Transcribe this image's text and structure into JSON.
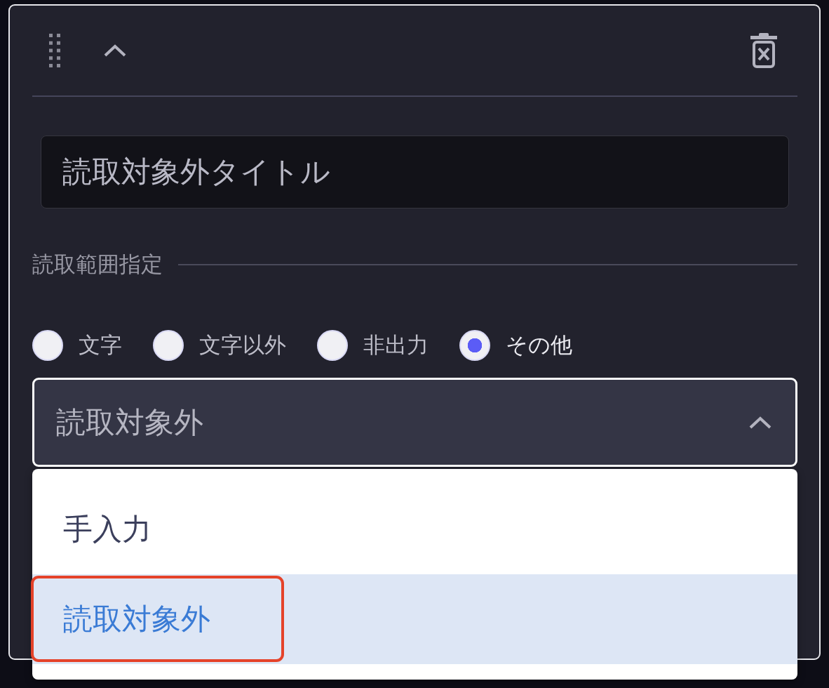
{
  "panel": {
    "expanded": true
  },
  "title_field": {
    "value": "読取対象外タイトル"
  },
  "range_section": {
    "label": "読取範囲指定"
  },
  "range_options": [
    {
      "label": "文字",
      "selected": false
    },
    {
      "label": "文字以外",
      "selected": false
    },
    {
      "label": "非出力",
      "selected": false
    },
    {
      "label": "その他",
      "selected": true
    }
  ],
  "select": {
    "value": "読取対象外",
    "expanded": true,
    "options": [
      {
        "label": "手入力",
        "selected": false,
        "annotated": false
      },
      {
        "label": "読取対象外",
        "selected": true,
        "annotated": true
      }
    ]
  }
}
